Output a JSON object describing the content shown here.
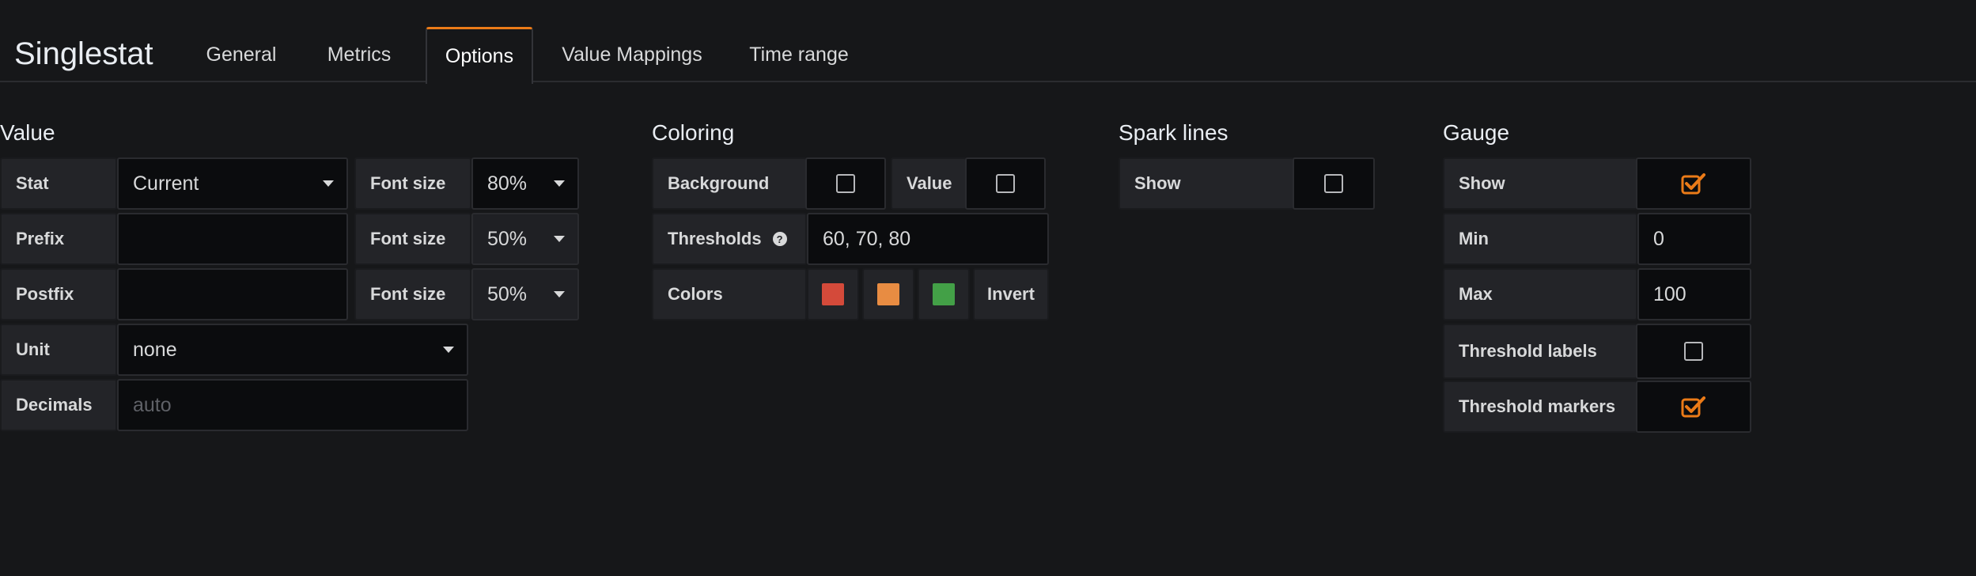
{
  "header": {
    "title": "Singlestat",
    "tabs": [
      {
        "label": "General"
      },
      {
        "label": "Metrics"
      },
      {
        "label": "Options"
      },
      {
        "label": "Value Mappings"
      },
      {
        "label": "Time range"
      }
    ],
    "active_tab": "Options"
  },
  "value": {
    "title": "Value",
    "stat_label": "Stat",
    "stat_value": "Current",
    "prefix_label": "Prefix",
    "prefix_value": "",
    "postfix_label": "Postfix",
    "postfix_value": "",
    "font_size_label": "Font size",
    "stat_font_size": "80%",
    "prefix_font_size": "50%",
    "postfix_font_size": "50%",
    "unit_label": "Unit",
    "unit_value": "none",
    "decimals_label": "Decimals",
    "decimals_placeholder": "auto"
  },
  "coloring": {
    "title": "Coloring",
    "background_label": "Background",
    "background_checked": false,
    "value_label": "Value",
    "value_checked": false,
    "thresholds_label": "Thresholds",
    "thresholds_value": "60, 70, 80",
    "colors_label": "Colors",
    "colors": [
      "#d44a3a",
      "#e88c42",
      "#43a047"
    ],
    "invert_label": "Invert"
  },
  "spark_lines": {
    "title": "Spark lines",
    "show_label": "Show",
    "show_checked": false
  },
  "gauge": {
    "title": "Gauge",
    "show_label": "Show",
    "show_checked": true,
    "min_label": "Min",
    "min_value": "0",
    "max_label": "Max",
    "max_value": "100",
    "threshold_labels_label": "Threshold labels",
    "threshold_labels_checked": false,
    "threshold_markers_label": "Threshold markers",
    "threshold_markers_checked": true
  },
  "theme": {
    "accent": "#eb7b18",
    "background": "#161719",
    "label_bg": "#232428",
    "input_bg": "#0b0c0e"
  }
}
